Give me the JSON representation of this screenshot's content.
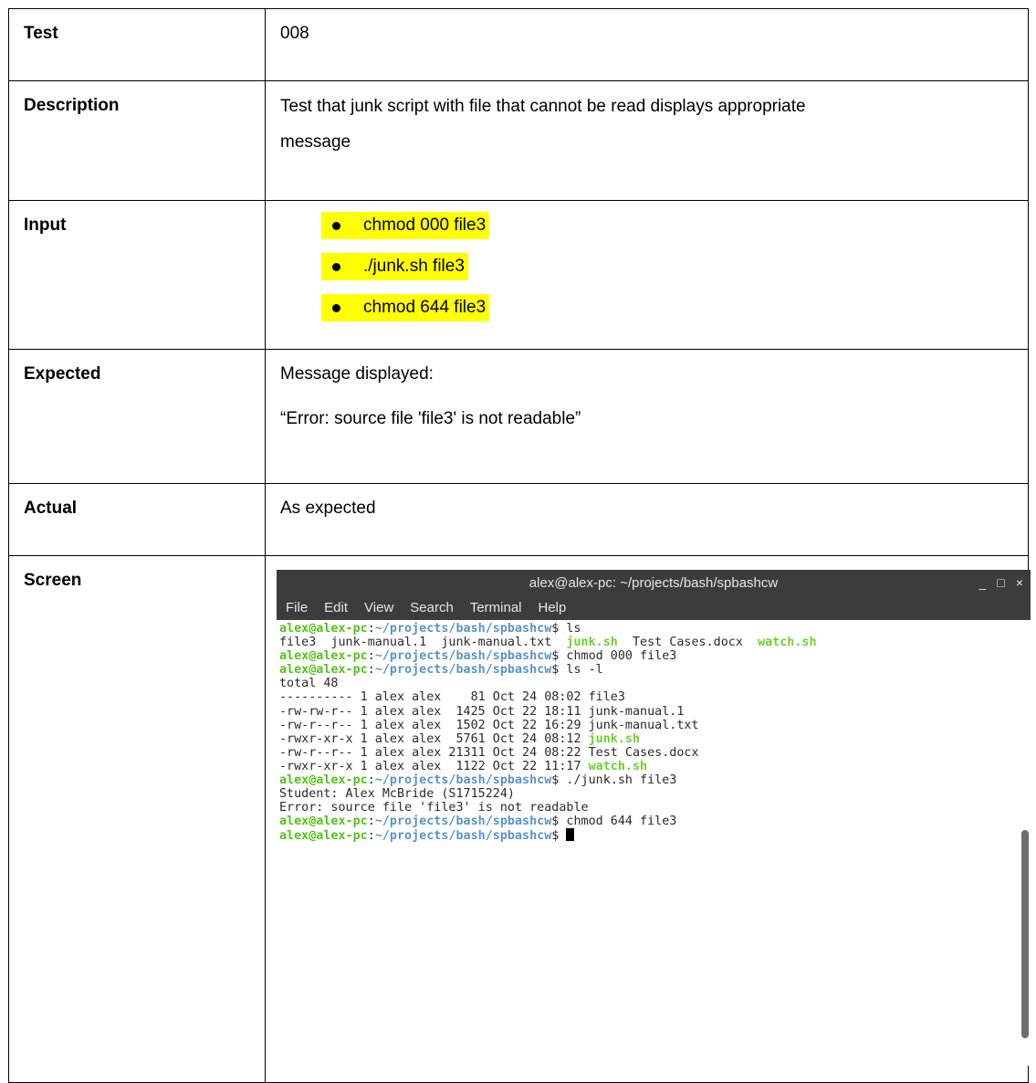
{
  "rows": {
    "test": {
      "label": "Test",
      "value": "008"
    },
    "description": {
      "label": "Description",
      "line1": "Test that junk script with file that cannot be read displays appropriate",
      "line2": "message"
    },
    "input": {
      "label": "Input",
      "items": [
        "chmod 000 file3",
        "./junk.sh file3",
        "chmod 644 file3"
      ]
    },
    "expected": {
      "label": "Expected",
      "line1": "Message displayed:",
      "line2": "“Error: source file 'file3' is not readable”"
    },
    "actual": {
      "label": "Actual",
      "value": "As expected"
    },
    "screen": {
      "label": "Screen"
    }
  },
  "terminal": {
    "title": "alex@alex-pc: ~/projects/bash/spbashcw",
    "controls": [
      "_",
      "□",
      "×"
    ],
    "menu": [
      "File",
      "Edit",
      "View",
      "Search",
      "Terminal",
      "Help"
    ],
    "prompt_user": "alex@alex-pc",
    "prompt_path": "~/projects/bash/spbashcw",
    "prompt_end": "$",
    "lines": [
      {
        "type": "prompt",
        "cmd": " ls"
      },
      {
        "type": "files"
      },
      {
        "type": "prompt",
        "cmd": " chmod 000 file3"
      },
      {
        "type": "prompt",
        "cmd": " ls -l"
      },
      {
        "type": "out",
        "text": "total 48"
      },
      {
        "type": "out",
        "text": "---------- 1 alex alex    81 Oct 24 08:02 file3"
      },
      {
        "type": "out",
        "text": "-rw-rw-r-- 1 alex alex  1425 Oct 22 18:11 junk-manual.1"
      },
      {
        "type": "out",
        "text": "-rw-r--r-- 1 alex alex  1502 Oct 22 16:29 junk-manual.txt"
      },
      {
        "type": "outexe",
        "text": "-rwxr-xr-x 1 alex alex  5761 Oct 24 08:12 ",
        "exe": "junk.sh"
      },
      {
        "type": "out",
        "text": "-rw-r--r-- 1 alex alex 21311 Oct 24 08:22 Test Cases.docx"
      },
      {
        "type": "outexe",
        "text": "-rwxr-xr-x 1 alex alex  1122 Oct 22 11:17 ",
        "exe": "watch.sh"
      },
      {
        "type": "prompt",
        "cmd": " ./junk.sh file3"
      },
      {
        "type": "out",
        "text": "Student: Alex McBride (S1715224)"
      },
      {
        "type": "out",
        "text": "Error: source file 'file3' is not readable"
      },
      {
        "type": "prompt",
        "cmd": " chmod 644 file3"
      },
      {
        "type": "promptcursor",
        "cmd": " "
      }
    ],
    "ls_files": [
      {
        "name": "file3",
        "exe": false,
        "sep": "  "
      },
      {
        "name": "junk-manual.1",
        "exe": false,
        "sep": "  "
      },
      {
        "name": "junk-manual.txt",
        "exe": false,
        "sep": "  "
      },
      {
        "name": "junk.sh",
        "exe": true,
        "sep": "  "
      },
      {
        "name": "Test Cases.docx",
        "exe": false,
        "sep": "  "
      },
      {
        "name": "watch.sh",
        "exe": true,
        "sep": ""
      }
    ]
  }
}
